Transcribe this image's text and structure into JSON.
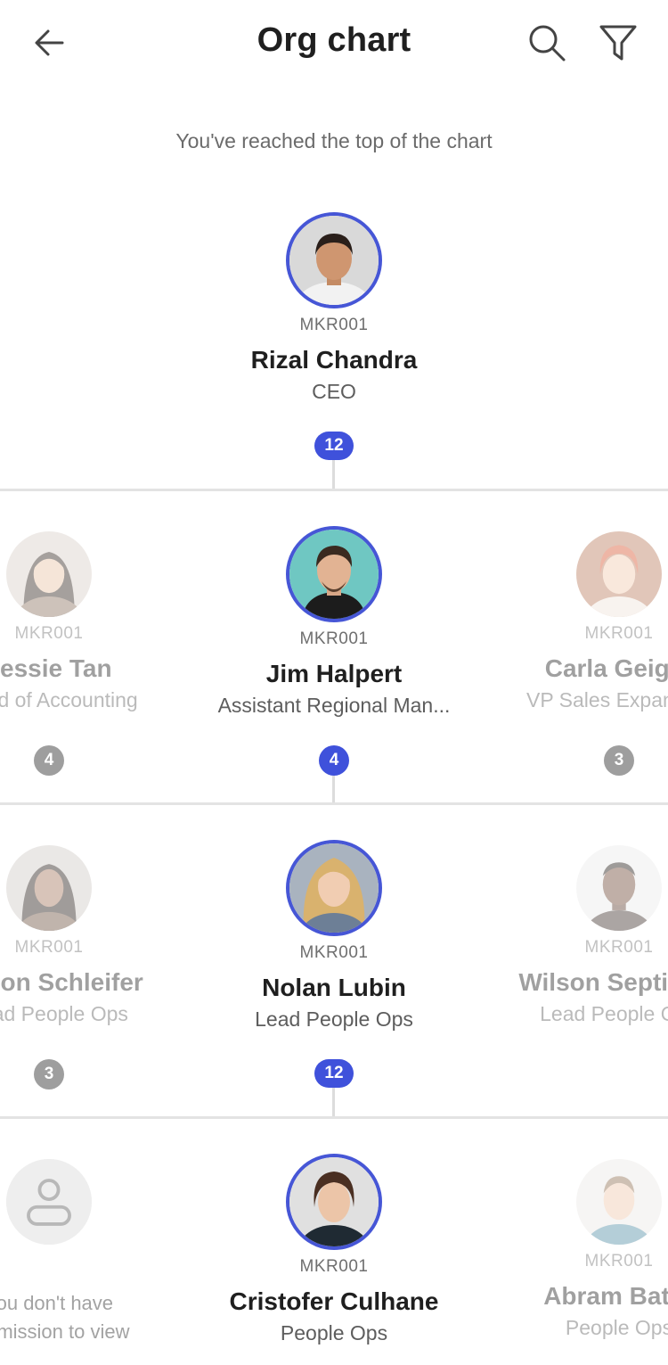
{
  "header": {
    "title": "Org chart",
    "back_icon": "arrow-left-icon",
    "search_icon": "search-icon",
    "filter_icon": "filter-icon"
  },
  "top_message": "You've reached the top of the chart",
  "colors": {
    "accent": "#3f51db",
    "badge_grey": "#9e9e9e",
    "divider": "#e3e3e3"
  },
  "levels": [
    {
      "center": {
        "code": "MKR001",
        "name": "Rizal Chandra",
        "role": "CEO",
        "reports": "12"
      }
    },
    {
      "left": {
        "code": "MKR001",
        "name": "Jessie Tan",
        "role": "Head of Accounting",
        "reports": "4"
      },
      "center": {
        "code": "MKR001",
        "name": "Jim Halpert",
        "role": "Assistant Regional Man...",
        "reports": "4"
      },
      "right": {
        "code": "MKR001",
        "name": "Carla Geiger",
        "role": "VP Sales Expansion",
        "reports": "3"
      }
    },
    {
      "left": {
        "code": "MKR001",
        "name": "Alison Schleifer",
        "role": "Lead People Ops",
        "reports": "3"
      },
      "center": {
        "code": "MKR001",
        "name": "Nolan Lubin",
        "role": "Lead People Ops",
        "reports": "12"
      },
      "right": {
        "code": "MKR001",
        "name": "Wilson Septimus",
        "role": "Lead People Ops"
      }
    },
    {
      "left": {
        "no_permission_line1": "You don't have",
        "no_permission_line2": "permission to view"
      },
      "center": {
        "code": "MKR001",
        "name": "Cristofer Culhane",
        "role": "People Ops"
      },
      "right": {
        "code": "MKR001",
        "name": "Abram Bator",
        "role": "People Ops"
      }
    }
  ]
}
